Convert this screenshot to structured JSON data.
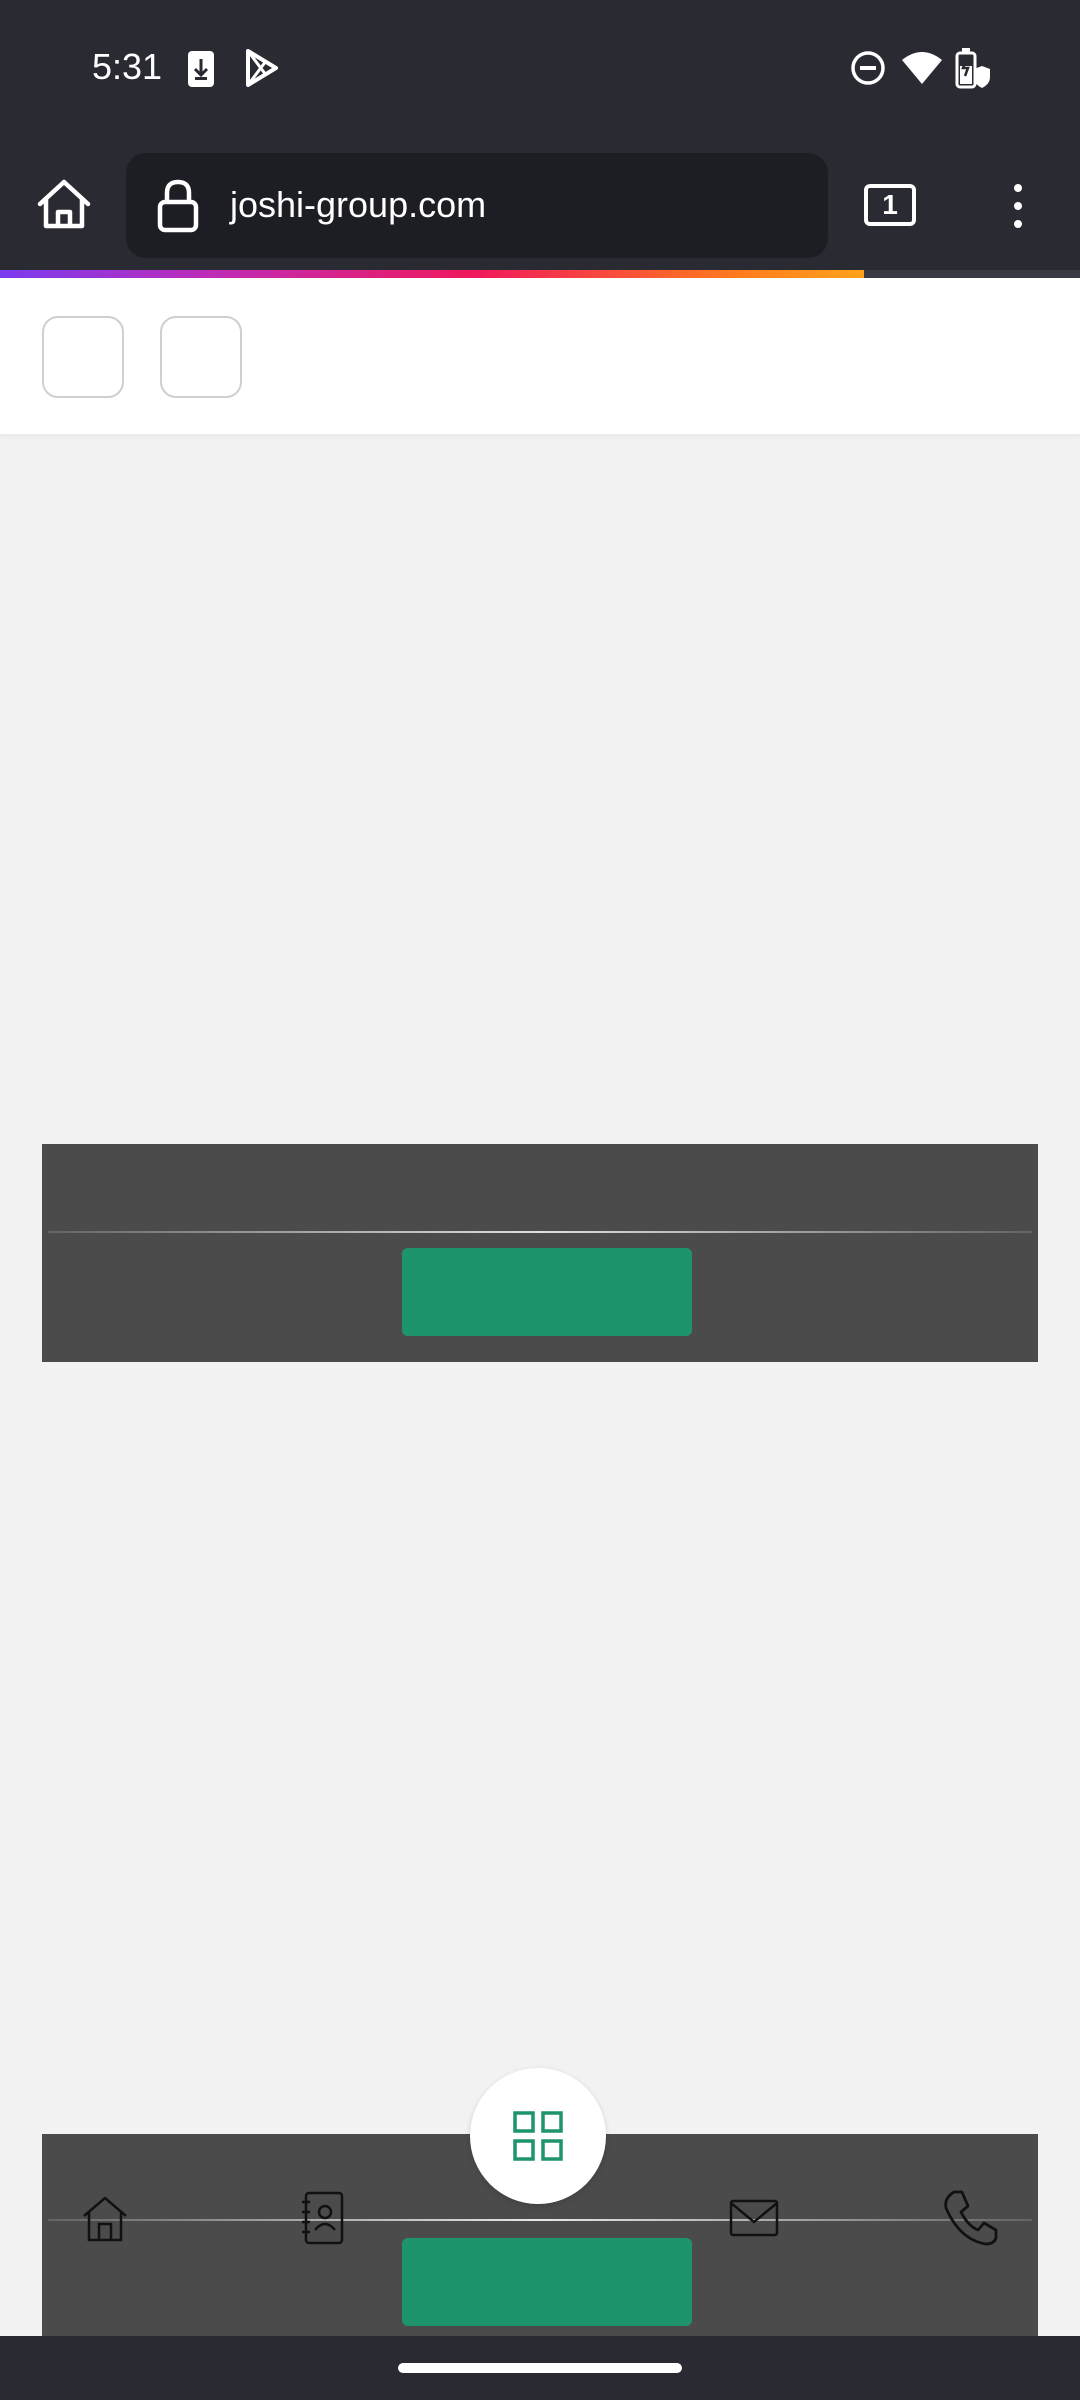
{
  "status_bar": {
    "time": "5:31",
    "left_icons": [
      "download-notification-icon",
      "play-store-icon"
    ],
    "right_icons": [
      "do-not-disturb-icon",
      "wifi-icon",
      "battery-icon"
    ]
  },
  "browser": {
    "url": "joshi-group.com",
    "tab_count": "1",
    "icons": [
      "home-icon",
      "lock-icon",
      "tabs-icon",
      "overflow-menu-icon"
    ],
    "progress_fraction": 0.8
  },
  "page": {
    "header_buttons": [
      "",
      ""
    ],
    "banner_button_label": "",
    "bottom_nav": {
      "items": [
        "home-icon",
        "contacts-book-icon",
        "mail-icon",
        "phone-icon"
      ],
      "fab_icon": "grid-icon",
      "cta_label": ""
    }
  },
  "colors": {
    "chrome_bg": "#2a2a33",
    "url_box_bg": "#1d1d24",
    "page_bg": "#f2f2f2",
    "panel_bg": "#4b4b4b",
    "accent_green": "#1e946c"
  }
}
